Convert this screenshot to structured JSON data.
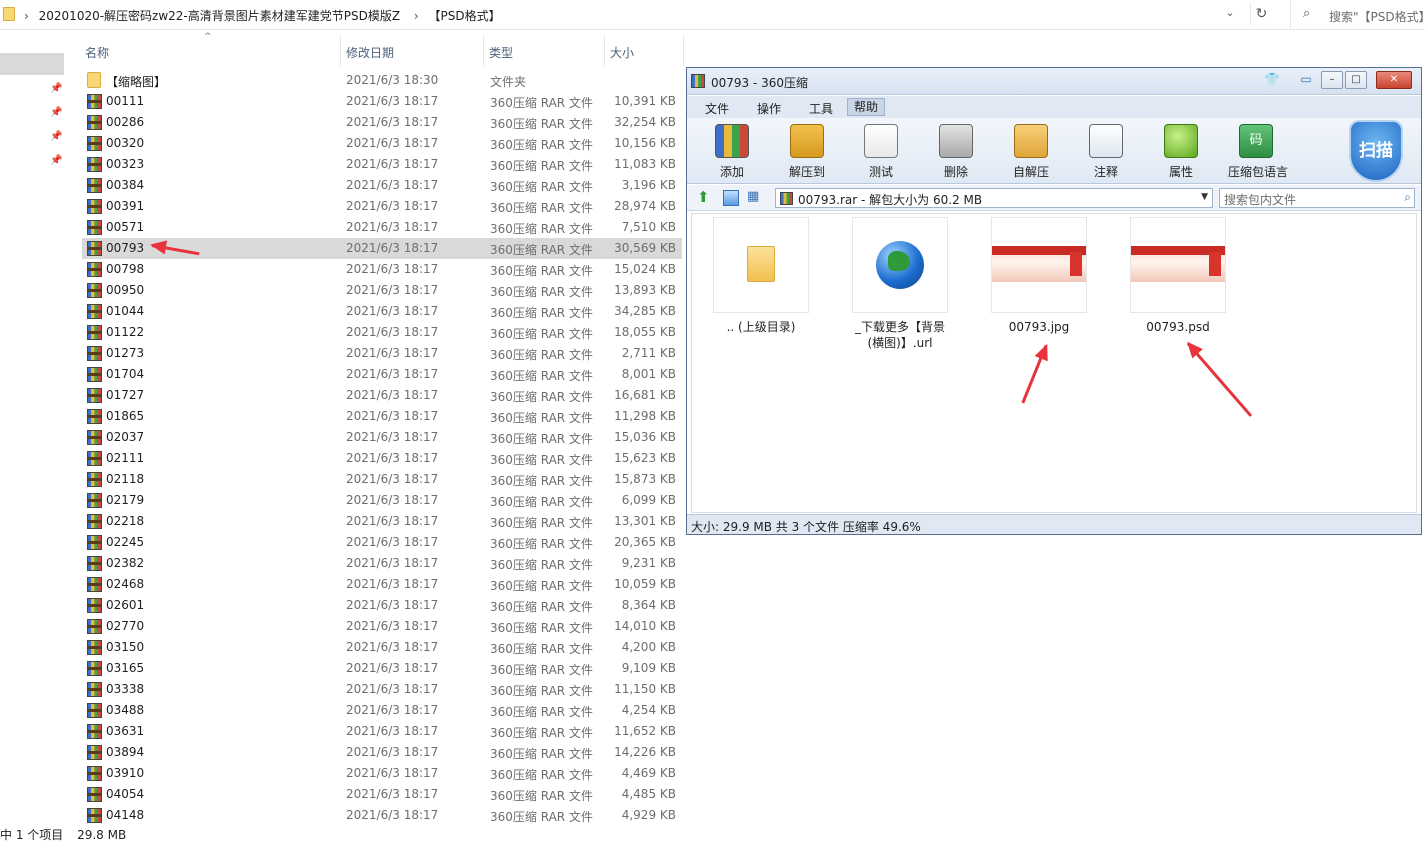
{
  "explorer": {
    "address": {
      "path": [
        "20201020-解压密码zw22-高清背景图片素材建军建党节PSD模版Z",
        "【PSD格式】"
      ],
      "search_placeholder": "搜索\"【PSD格式】"
    },
    "columns": {
      "name": "名称",
      "date": "修改日期",
      "type": "类型",
      "size": "大小"
    },
    "rows": [
      {
        "name": "【缩略图】",
        "date": "2021/6/3 18:30",
        "type": "文件夹",
        "size": "",
        "kind": "folder"
      },
      {
        "name": "00111",
        "date": "2021/6/3 18:17",
        "type": "360压缩 RAR 文件",
        "size": "10,391 KB",
        "kind": "rar"
      },
      {
        "name": "00286",
        "date": "2021/6/3 18:17",
        "type": "360压缩 RAR 文件",
        "size": "32,254 KB",
        "kind": "rar"
      },
      {
        "name": "00320",
        "date": "2021/6/3 18:17",
        "type": "360压缩 RAR 文件",
        "size": "10,156 KB",
        "kind": "rar"
      },
      {
        "name": "00323",
        "date": "2021/6/3 18:17",
        "type": "360压缩 RAR 文件",
        "size": "11,083 KB",
        "kind": "rar"
      },
      {
        "name": "00384",
        "date": "2021/6/3 18:17",
        "type": "360压缩 RAR 文件",
        "size": "3,196 KB",
        "kind": "rar"
      },
      {
        "name": "00391",
        "date": "2021/6/3 18:17",
        "type": "360压缩 RAR 文件",
        "size": "28,974 KB",
        "kind": "rar"
      },
      {
        "name": "00571",
        "date": "2021/6/3 18:17",
        "type": "360压缩 RAR 文件",
        "size": "7,510 KB",
        "kind": "rar"
      },
      {
        "name": "00793",
        "date": "2021/6/3 18:17",
        "type": "360压缩 RAR 文件",
        "size": "30,569 KB",
        "kind": "rar",
        "selected": true
      },
      {
        "name": "00798",
        "date": "2021/6/3 18:17",
        "type": "360压缩 RAR 文件",
        "size": "15,024 KB",
        "kind": "rar"
      },
      {
        "name": "00950",
        "date": "2021/6/3 18:17",
        "type": "360压缩 RAR 文件",
        "size": "13,893 KB",
        "kind": "rar"
      },
      {
        "name": "01044",
        "date": "2021/6/3 18:17",
        "type": "360压缩 RAR 文件",
        "size": "34,285 KB",
        "kind": "rar"
      },
      {
        "name": "01122",
        "date": "2021/6/3 18:17",
        "type": "360压缩 RAR 文件",
        "size": "18,055 KB",
        "kind": "rar"
      },
      {
        "name": "01273",
        "date": "2021/6/3 18:17",
        "type": "360压缩 RAR 文件",
        "size": "2,711 KB",
        "kind": "rar"
      },
      {
        "name": "01704",
        "date": "2021/6/3 18:17",
        "type": "360压缩 RAR 文件",
        "size": "8,001 KB",
        "kind": "rar"
      },
      {
        "name": "01727",
        "date": "2021/6/3 18:17",
        "type": "360压缩 RAR 文件",
        "size": "16,681 KB",
        "kind": "rar"
      },
      {
        "name": "01865",
        "date": "2021/6/3 18:17",
        "type": "360压缩 RAR 文件",
        "size": "11,298 KB",
        "kind": "rar"
      },
      {
        "name": "02037",
        "date": "2021/6/3 18:17",
        "type": "360压缩 RAR 文件",
        "size": "15,036 KB",
        "kind": "rar"
      },
      {
        "name": "02111",
        "date": "2021/6/3 18:17",
        "type": "360压缩 RAR 文件",
        "size": "15,623 KB",
        "kind": "rar"
      },
      {
        "name": "02118",
        "date": "2021/6/3 18:17",
        "type": "360压缩 RAR 文件",
        "size": "15,873 KB",
        "kind": "rar"
      },
      {
        "name": "02179",
        "date": "2021/6/3 18:17",
        "type": "360压缩 RAR 文件",
        "size": "6,099 KB",
        "kind": "rar"
      },
      {
        "name": "02218",
        "date": "2021/6/3 18:17",
        "type": "360压缩 RAR 文件",
        "size": "13,301 KB",
        "kind": "rar"
      },
      {
        "name": "02245",
        "date": "2021/6/3 18:17",
        "type": "360压缩 RAR 文件",
        "size": "20,365 KB",
        "kind": "rar"
      },
      {
        "name": "02382",
        "date": "2021/6/3 18:17",
        "type": "360压缩 RAR 文件",
        "size": "9,231 KB",
        "kind": "rar"
      },
      {
        "name": "02468",
        "date": "2021/6/3 18:17",
        "type": "360压缩 RAR 文件",
        "size": "10,059 KB",
        "kind": "rar"
      },
      {
        "name": "02601",
        "date": "2021/6/3 18:17",
        "type": "360压缩 RAR 文件",
        "size": "8,364 KB",
        "kind": "rar"
      },
      {
        "name": "02770",
        "date": "2021/6/3 18:17",
        "type": "360压缩 RAR 文件",
        "size": "14,010 KB",
        "kind": "rar"
      },
      {
        "name": "03150",
        "date": "2021/6/3 18:17",
        "type": "360压缩 RAR 文件",
        "size": "4,200 KB",
        "kind": "rar"
      },
      {
        "name": "03165",
        "date": "2021/6/3 18:17",
        "type": "360压缩 RAR 文件",
        "size": "9,109 KB",
        "kind": "rar"
      },
      {
        "name": "03338",
        "date": "2021/6/3 18:17",
        "type": "360压缩 RAR 文件",
        "size": "11,150 KB",
        "kind": "rar"
      },
      {
        "name": "03488",
        "date": "2021/6/3 18:17",
        "type": "360压缩 RAR 文件",
        "size": "4,254 KB",
        "kind": "rar"
      },
      {
        "name": "03631",
        "date": "2021/6/3 18:17",
        "type": "360压缩 RAR 文件",
        "size": "11,652 KB",
        "kind": "rar"
      },
      {
        "name": "03894",
        "date": "2021/6/3 18:17",
        "type": "360压缩 RAR 文件",
        "size": "14,226 KB",
        "kind": "rar"
      },
      {
        "name": "03910",
        "date": "2021/6/3 18:17",
        "type": "360压缩 RAR 文件",
        "size": "4,469 KB",
        "kind": "rar"
      },
      {
        "name": "04054",
        "date": "2021/6/3 18:17",
        "type": "360压缩 RAR 文件",
        "size": "4,485 KB",
        "kind": "rar"
      },
      {
        "name": "04148",
        "date": "2021/6/3 18:17",
        "type": "360压缩 RAR 文件",
        "size": "4,929 KB",
        "kind": "rar"
      }
    ],
    "status": {
      "selected": "中 1 个项目",
      "size": "29.8 MB"
    }
  },
  "archive": {
    "title": "00793 - 360压缩",
    "menu": [
      "文件",
      "操作",
      "工具",
      "帮助"
    ],
    "menu_active_index": 3,
    "tools": [
      "添加",
      "解压到",
      "测试",
      "删除",
      "自解压",
      "注释",
      "属性",
      "压缩包语言"
    ],
    "scan_label": "扫描",
    "path": "00793.rar - 解包大小为 60.2 MB",
    "search_placeholder": "搜索包内文件",
    "items": [
      {
        "label": ".. (上级目录)",
        "icon": "folder-up-icon"
      },
      {
        "label": "_下载更多【背景(横图)】.url",
        "icon": "globe-icon"
      },
      {
        "label": "00793.jpg",
        "icon": "image-thumbnail"
      },
      {
        "label": "00793.psd",
        "icon": "image-thumbnail"
      }
    ],
    "status": "大小: 29.9 MB 共 3 个文件 压缩率 49.6%"
  },
  "colors": {
    "annotation_arrow": "#e8323c",
    "selected_row": "#d9d9d9"
  }
}
